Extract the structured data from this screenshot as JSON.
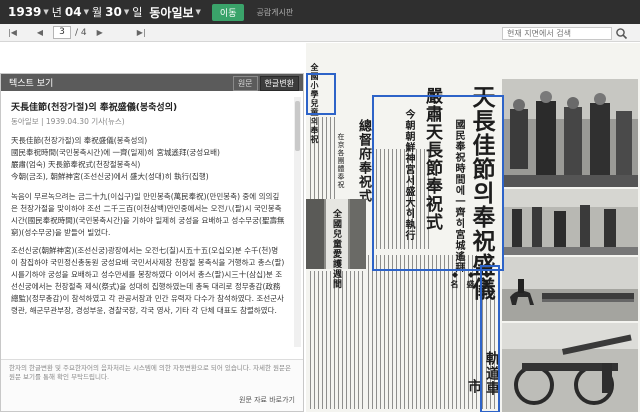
{
  "topbar": {
    "year": "1939",
    "year_unit": "년",
    "month": "04",
    "month_unit": "월",
    "day": "30",
    "day_unit": "일",
    "paper": "동아일보",
    "go_label": "이동",
    "notice": "공람게시판"
  },
  "nav": {
    "current_page": "3",
    "total_pages": "/ 4",
    "search_placeholder": "현재 지면에서 검색"
  },
  "panel": {
    "title": "텍스트 보기",
    "lang_original": "원문",
    "lang_korean": "한글변환",
    "article_title": "天長佳節(천장가절)의 奉祝盛儀(봉축성의)",
    "article_meta": "동아일보 | 1939.04.30 기사(뉴스)",
    "sub1": "天長佳節(천장가절)의 奉祝盛儀(봉축성의)",
    "sub2": "國民奉祝時間(국민봉축시간)에 一齊(일제)히 宮城遙拜(궁성요배)",
    "sub3": "嚴肅(엄숙) 天長節奉祝式(천장절봉축식)",
    "sub4": "今朝(금조), 朝鮮神宮(조선신궁)에서 盛大(성대)히 執行(집행)",
    "para1": "녹음이 무르녹으려는 금二十九(이십구)일 만민봉축(萬民奉祝)(만민봉축) 중에 의의깊은 천장가절을 맞이하야 조선 二千三百(이천삼백)만민중에서는 오전八(팔)시 국민봉축시간(國民奉祝時間)(국민봉축시간)을 기하야 일제히 궁성을 요배하고 성수무궁(聖壽無窮)(성수무궁)을 받들어 빌었다.",
    "para2": "조선신궁(朝鮮神宮)(조선신궁)광장에서는 오전七(칠)시五十五(오십오)분 수千(천)명이 참집하야 국민정신총동원 궁성요배 국민서사제창 천장절 봉축식을 거행하고 총스(팔)시를기하야 궁성을 요배하고 성수만세를 봉창하였다 이어서 총스(팔)시三十(삼십)분 조선신궁에서는 천장절축 제식(祭式)을 성대히 집행하였는데 총독 대리로 정무총감(政務總監)(정무총감)이 참석하였고 각 관공서장과 민간 유력자 다수가 참석하였다. 조선군사령관, 해군무관부장, 경성부윤, 경찰국장, 각국 영사, 기타 각 단체 대표도 참렬하였다.",
    "footer": "한자의 한글변환 및 주요한자어의 음차처리는 시스템에 의한 자동변환으로 되어 있습니다. 자세한 원문은 원문 보기를 통해 확인 부탁드립니다.",
    "footer_link": "원문 자료 바로가기"
  },
  "newspaper": {
    "headline1": "天長佳節의奉祝盛儀",
    "headline2": "嚴肅天長節奉祝式",
    "headline3": "國民奉祝時間에一齊히宮城遙拜",
    "headline4": "今朝朝鮮神宮서盛大히執行",
    "side1": "總督府奉祝式",
    "side2": "在京各團體奉祝",
    "side3": "全國小學兒童의奉祝",
    "banner": "全國兒童愛護週間",
    "corner": "軌道車",
    "corner2": "市",
    "small1": "◆名",
    "small2": "◆盛",
    "small3": "◆聖"
  },
  "colors": {
    "topbar_bg": "#2f2f2f",
    "go_button": "#3aa36a",
    "highlight": "#2d63c8",
    "link_blue": "#2455a5"
  },
  "icons": [
    "chevron-down-icon",
    "first-page-icon",
    "prev-page-icon",
    "next-page-icon",
    "last-page-icon",
    "search-icon"
  ]
}
